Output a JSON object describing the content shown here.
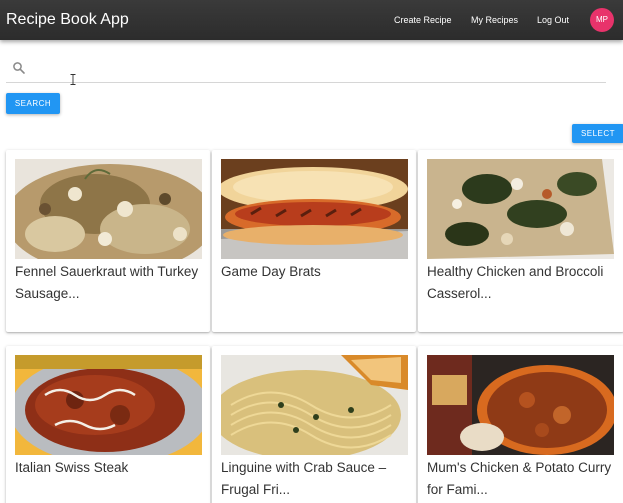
{
  "app": {
    "title": "Recipe Book App"
  },
  "nav": {
    "create": "Create Recipe",
    "mine": "My Recipes",
    "logout": "Log Out",
    "avatar_initials": "MP"
  },
  "search": {
    "value": "",
    "placeholder": "",
    "button_label": "SEARCH",
    "icon": "search-icon"
  },
  "select_label": "SELECT",
  "colors": {
    "appbar": "#2e2e2e",
    "accent": "#2196f3",
    "avatar": "#e8336b"
  },
  "recipes": [
    {
      "name": "Fennel Sauerkraut with Turkey Sausage...",
      "image": "fennel-sauerkraut-photo"
    },
    {
      "name": "Game Day Brats",
      "image": "brats-photo"
    },
    {
      "name": "Healthy Chicken and Broccoli Casserol...",
      "image": "casserole-photo"
    },
    {
      "name": "Italian Swiss Steak",
      "image": "swiss-steak-photo"
    },
    {
      "name": "Linguine with Crab Sauce – Frugal Fri...",
      "image": "linguine-photo"
    },
    {
      "name": "Mum's Chicken & Potato Curry for Fami...",
      "image": "curry-photo"
    }
  ]
}
